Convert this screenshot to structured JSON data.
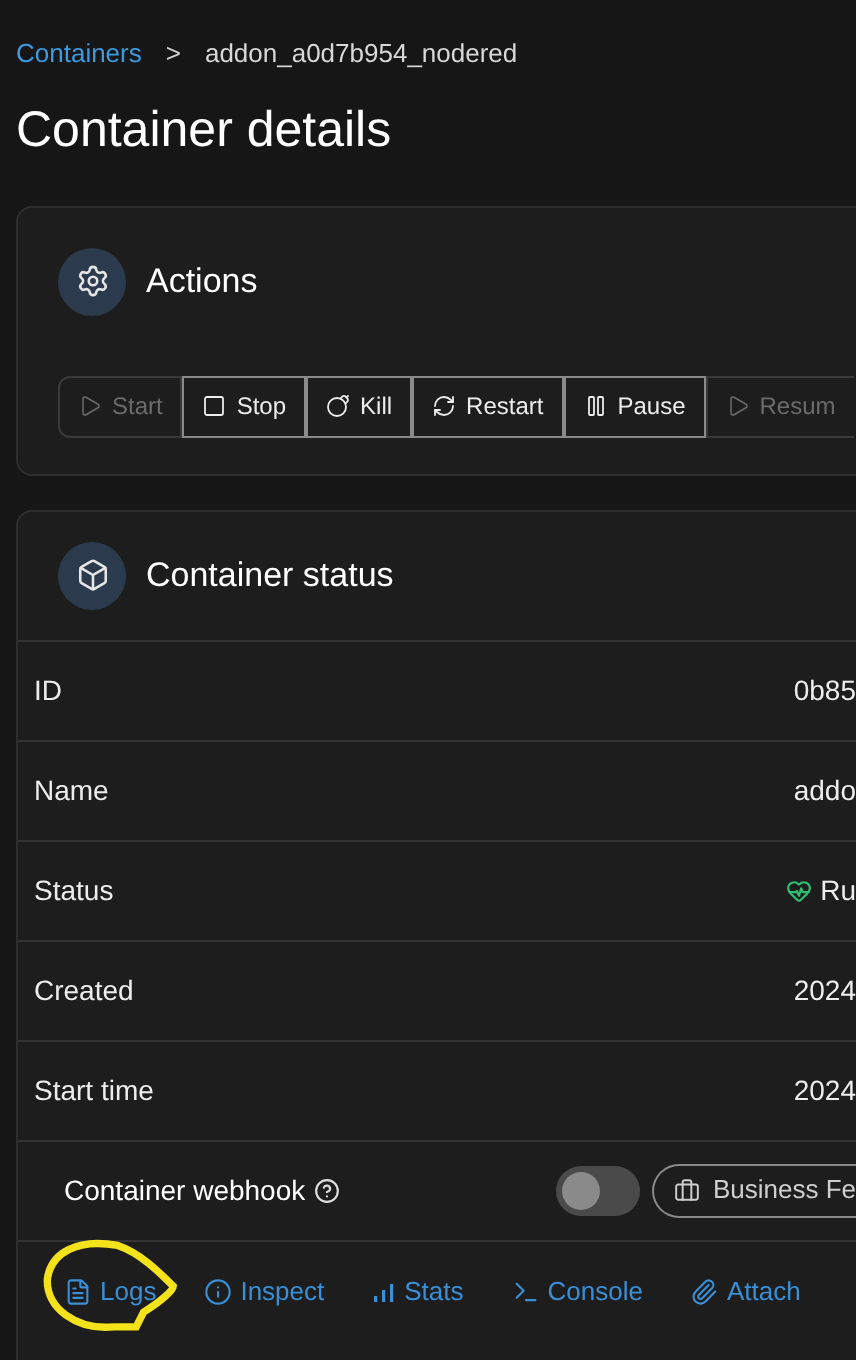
{
  "breadcrumb": {
    "link": "Containers",
    "separator": ">",
    "current": "addon_a0d7b954_nodered"
  },
  "title": "Container details",
  "actions": {
    "title": "Actions",
    "buttons": [
      {
        "label": "Start",
        "disabled": true
      },
      {
        "label": "Stop",
        "disabled": false
      },
      {
        "label": "Kill",
        "disabled": false
      },
      {
        "label": "Restart",
        "disabled": false
      },
      {
        "label": "Pause",
        "disabled": false
      },
      {
        "label": "Resum",
        "disabled": true
      }
    ]
  },
  "status": {
    "title": "Container status",
    "rows": [
      {
        "label": "ID",
        "value": "0b85",
        "kind": "text"
      },
      {
        "label": "Name",
        "value": "addo",
        "kind": "text"
      },
      {
        "label": "Status",
        "value": "Ru",
        "kind": "status"
      },
      {
        "label": "Created",
        "value": "2024",
        "kind": "text"
      },
      {
        "label": "Start time",
        "value": "2024",
        "kind": "text"
      }
    ],
    "webhook": {
      "label": "Container webhook",
      "on": false,
      "badge": "Business Fe"
    }
  },
  "tabs": [
    {
      "label": "Logs",
      "annotated": true
    },
    {
      "label": "Inspect",
      "annotated": false
    },
    {
      "label": "Stats",
      "annotated": false
    },
    {
      "label": "Console",
      "annotated": false
    },
    {
      "label": "Attach",
      "annotated": false
    }
  ]
}
